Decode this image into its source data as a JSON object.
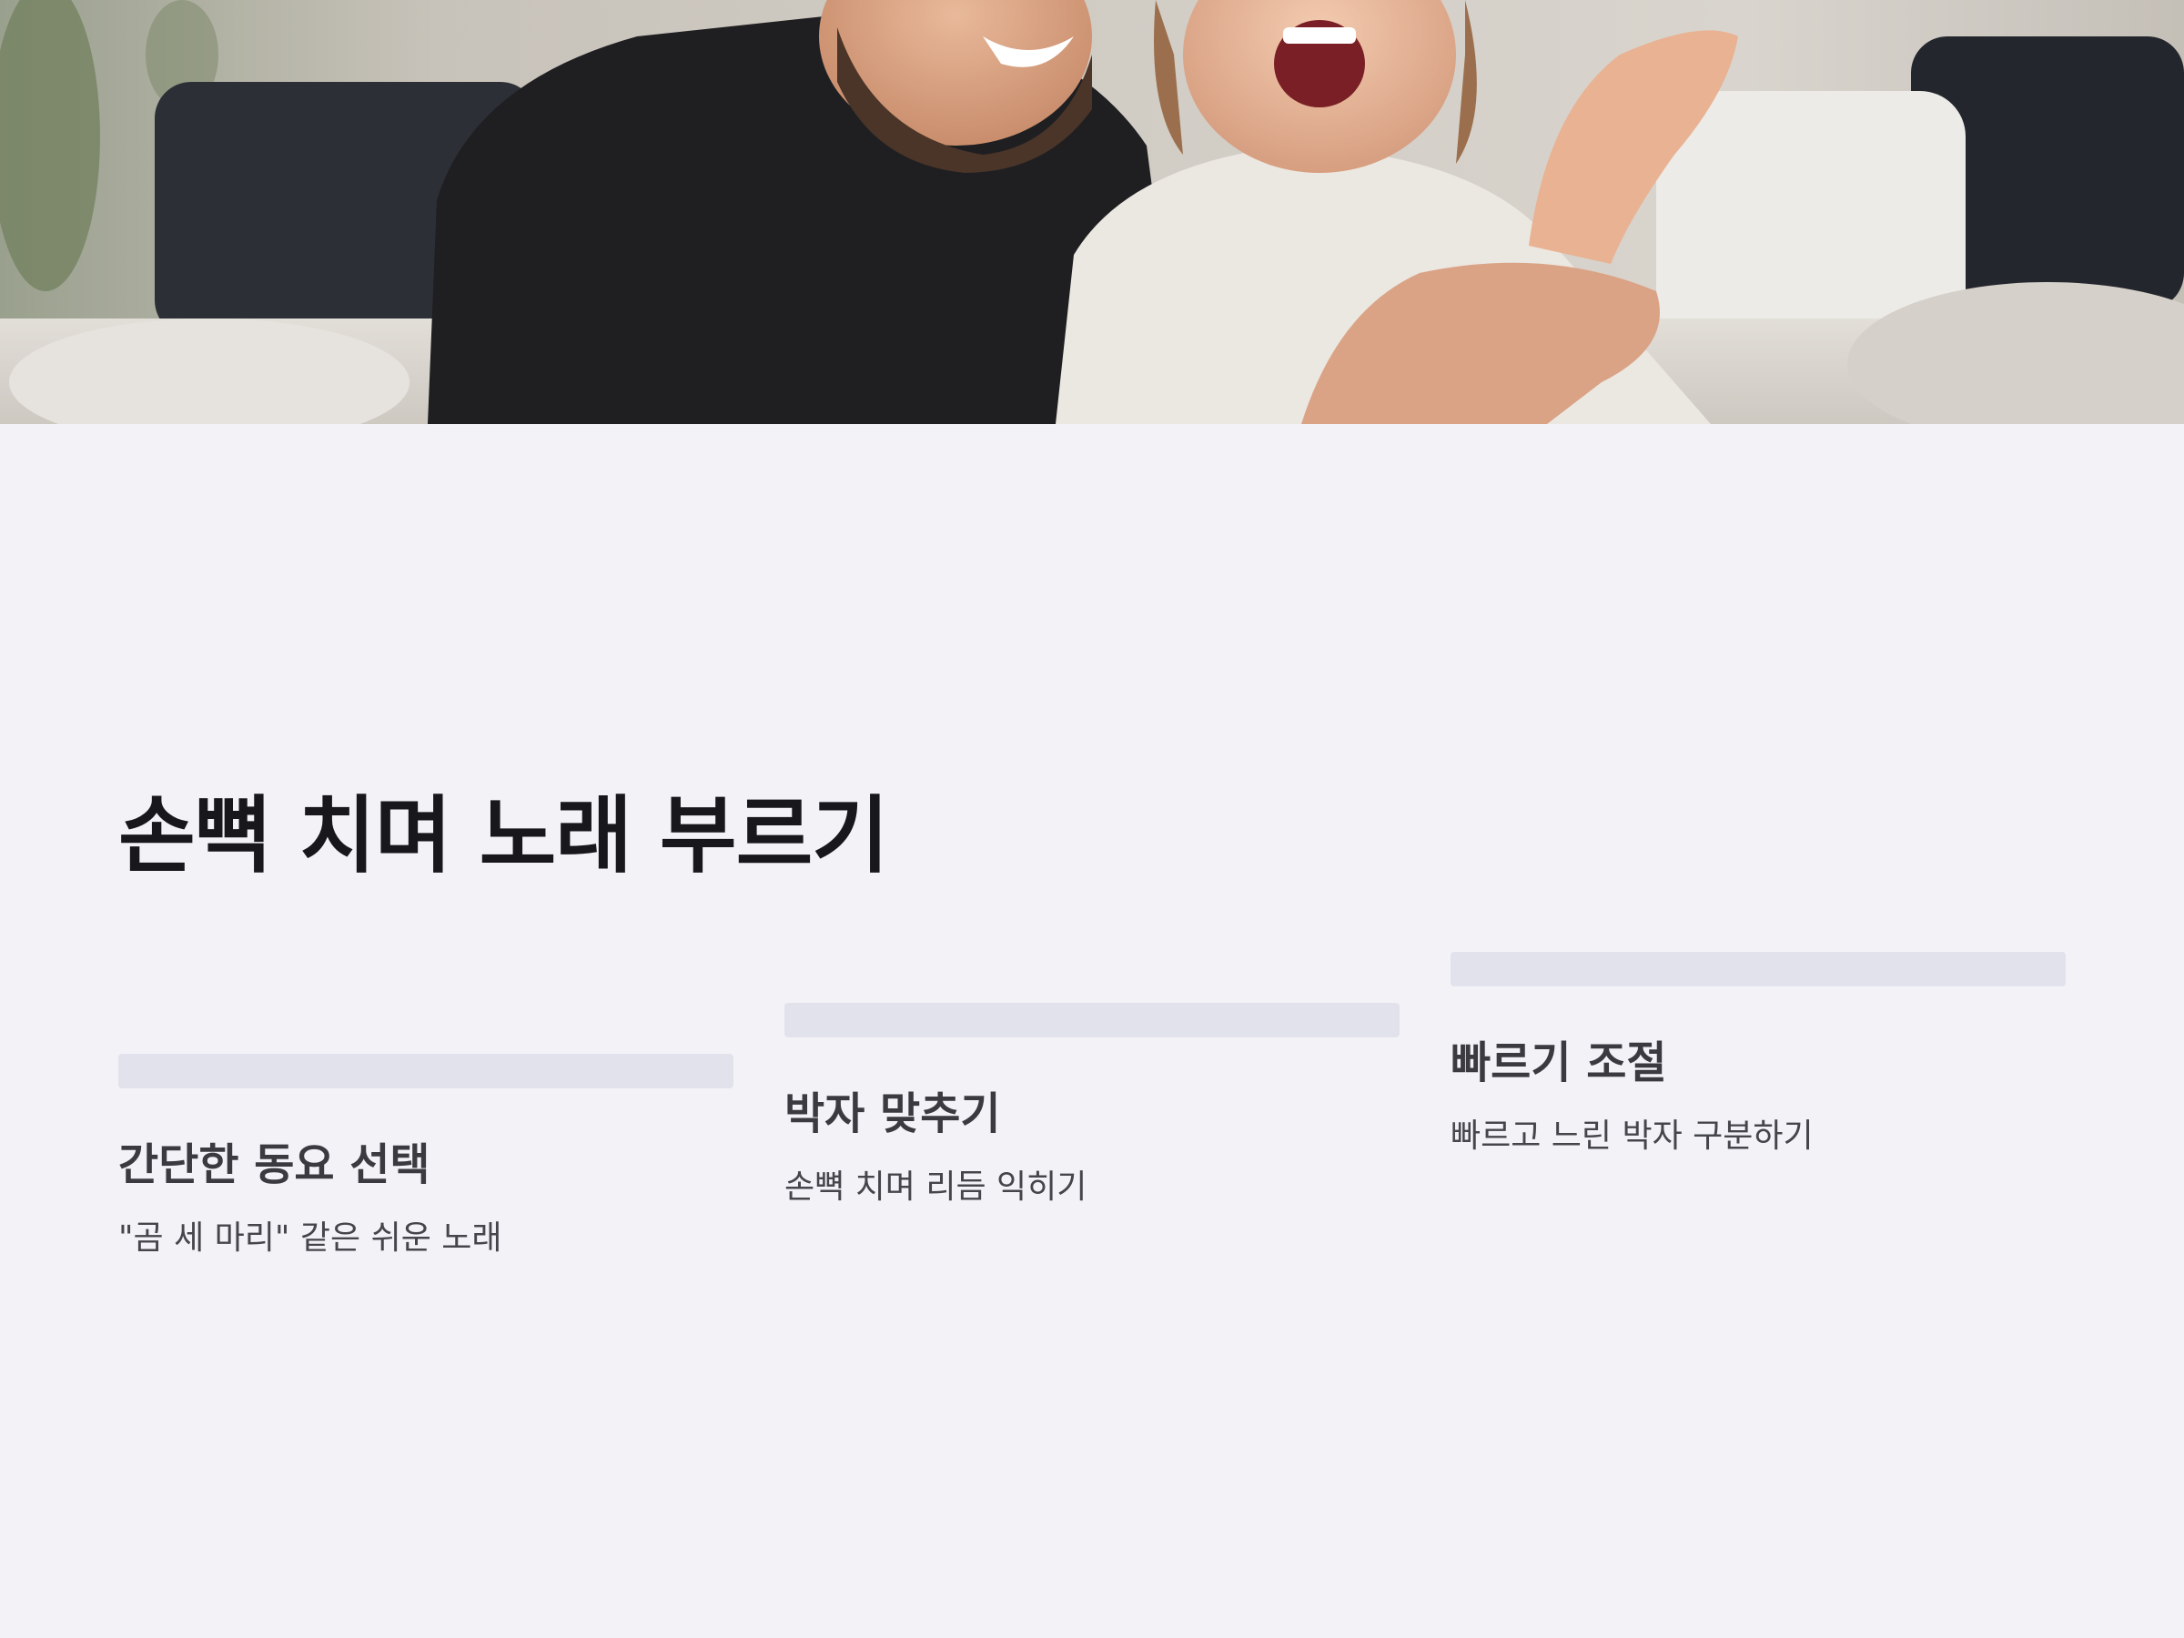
{
  "header_image": {
    "alt": "father-and-child-clapping-photo"
  },
  "title": "손뼉 치며 노래 부르기",
  "steps": [
    {
      "title": "간단한 동요 선택",
      "description": "\"곰 세 마리\" 같은 쉬운 노래"
    },
    {
      "title": "박자 맞추기",
      "description": "손뼉 치며 리듬 익히기"
    },
    {
      "title": "빠르기 조절",
      "description": "빠르고 느린 박자 구분하기"
    }
  ],
  "colors": {
    "background": "#f3f3f7",
    "bar": "#e2e2ec",
    "title": "#17171c",
    "text": "#45454c"
  }
}
